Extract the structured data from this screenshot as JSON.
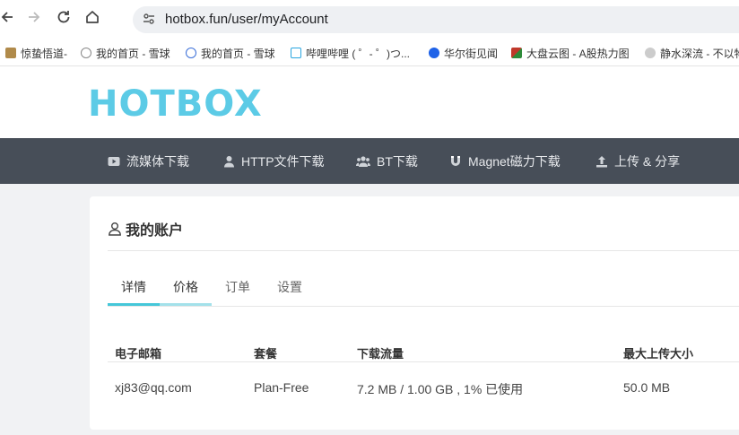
{
  "browser": {
    "url": "hotbox.fun/user/myAccount",
    "bookmarks": [
      {
        "label": "惊蛰悟道-",
        "color": "#b08a4a"
      },
      {
        "label": "我的首页 - 雪球",
        "color": "#888888"
      },
      {
        "label": "我的首页 - 雪球",
        "color": "#3b6fd8"
      },
      {
        "label": "哔哩哔哩 ( ゜- ゜)つ...",
        "color": "#2aa6e0"
      },
      {
        "label": "华尔街见闻",
        "color": "#1e62e8"
      },
      {
        "label": "大盘云图 - A股热力图",
        "color": "#c0392b"
      },
      {
        "label": "静水深流 - 不以物",
        "color": "#999999"
      }
    ]
  },
  "site": {
    "logo": "HOTBOX",
    "nav": [
      {
        "label": "流媒体下载",
        "icon": "youtube-icon"
      },
      {
        "label": "HTTP文件下载",
        "icon": "user-icon"
      },
      {
        "label": "BT下载",
        "icon": "users-icon"
      },
      {
        "label": "Magnet磁力下载",
        "icon": "magnet-icon"
      },
      {
        "label": "上传 & 分享",
        "icon": "upload-icon"
      }
    ]
  },
  "account": {
    "title": "我的账户",
    "tabs": [
      "详情",
      "价格",
      "订单",
      "设置"
    ],
    "active_tab": "详情",
    "columns": [
      "电子邮箱",
      "套餐",
      "下载流量",
      "最大上传大小"
    ],
    "row": [
      "xj83@qq.com",
      "Plan-Free",
      "7.2 MB / 1.00 GB , 1% 已使用",
      "50.0 MB"
    ]
  },
  "colors": {
    "accent": "#45c7d9",
    "accent_light": "#a3e1ea",
    "nav_bg": "#474e58",
    "page_bg": "#f1f2f4"
  }
}
